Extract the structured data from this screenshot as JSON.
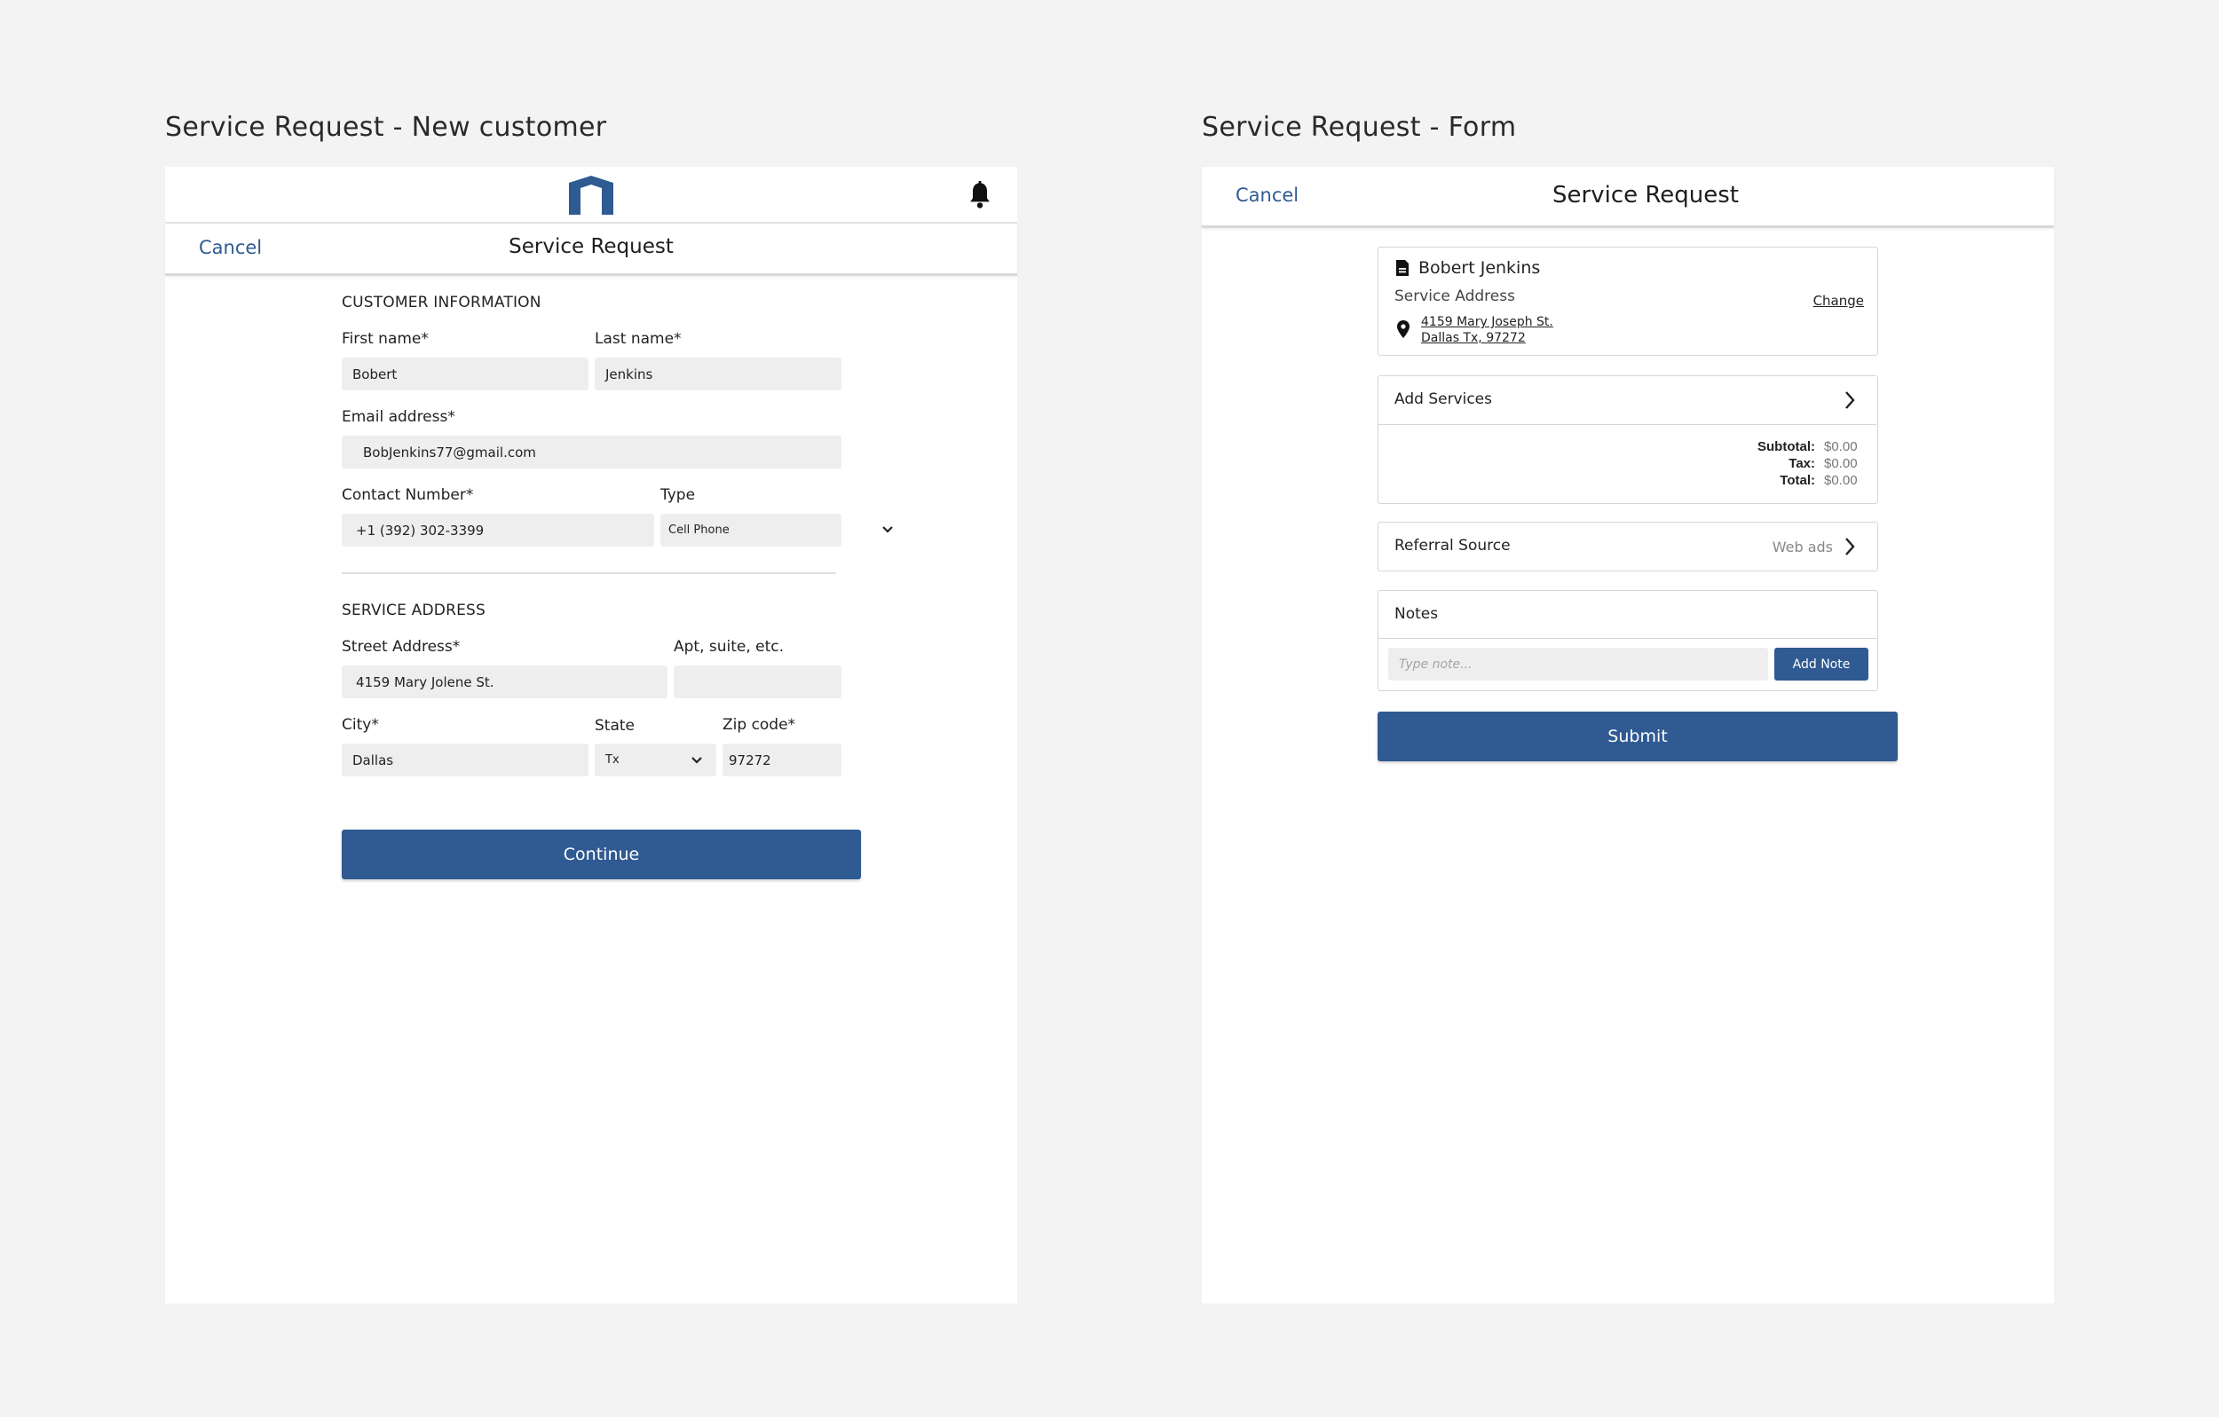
{
  "frames": {
    "left_title": "Service Request - New customer",
    "right_title": "Service Request - Form"
  },
  "colors": {
    "accent": "#2f5a92",
    "field_bg": "#eeeeee",
    "canvas": "#f3f3f3"
  },
  "new_customer": {
    "header": {
      "logo_icon": "brand-logo-icon",
      "bell_icon": "bell-icon"
    },
    "nav": {
      "cancel": "Cancel",
      "title": "Service Request"
    },
    "customer_info": {
      "heading": "CUSTOMER INFORMATION",
      "first_name_label": "First name*",
      "first_name_value": "Bobert",
      "last_name_label": "Last name*",
      "last_name_value": "Jenkins",
      "email_label": "Email address*",
      "email_value": "BobJenkins77@gmail.com",
      "contact_label": "Contact Number*",
      "contact_value": "+1 (392) 302-3399",
      "type_label": "Type",
      "type_value": "Cell Phone"
    },
    "service_address": {
      "heading": "SERVICE ADDRESS",
      "street_label": "Street Address*",
      "street_value": "4159 Mary Jolene St.",
      "apt_label": "Apt, suite, etc.",
      "apt_value": "",
      "city_label": "City*",
      "city_value": "Dallas",
      "state_label": "State",
      "state_value": "Tx",
      "zip_label": "Zip code*",
      "zip_value": "97272"
    },
    "continue_label": "Continue"
  },
  "form": {
    "nav": {
      "cancel": "Cancel",
      "title": "Service Request"
    },
    "customer_card": {
      "name": "Bobert Jenkins",
      "address_label": "Service Address",
      "change": "Change",
      "address_line1": "4159 Mary Joseph St.",
      "address_line2": "Dallas Tx, 97272"
    },
    "services_card": {
      "title": "Add Services",
      "subtotal_label": "Subtotal:",
      "subtotal_value": "$0.00",
      "tax_label": "Tax:",
      "tax_value": "$0.00",
      "total_label": "Total:",
      "total_value": "$0.00"
    },
    "referral_card": {
      "title": "Referral Source",
      "value": "Web ads"
    },
    "notes_card": {
      "title": "Notes",
      "placeholder": "Type note...",
      "button": "Add Note"
    },
    "submit_label": "Submit"
  }
}
